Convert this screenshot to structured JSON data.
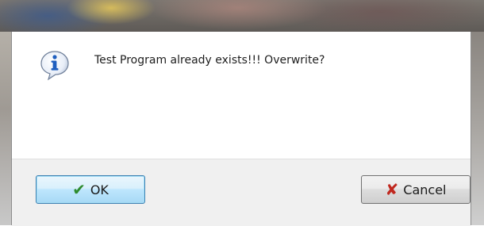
{
  "dialog": {
    "message": "Test Program already exists!!!  Overwrite?",
    "icon": "info-icon"
  },
  "buttons": {
    "ok_label": "OK",
    "ok_icon": "checkmark-icon",
    "cancel_label": "Cancel",
    "cancel_icon": "x-icon"
  },
  "colors": {
    "ok_check": "#2e8b2e",
    "cancel_x": "#c0281f",
    "info_blue": "#1f5fbf"
  }
}
